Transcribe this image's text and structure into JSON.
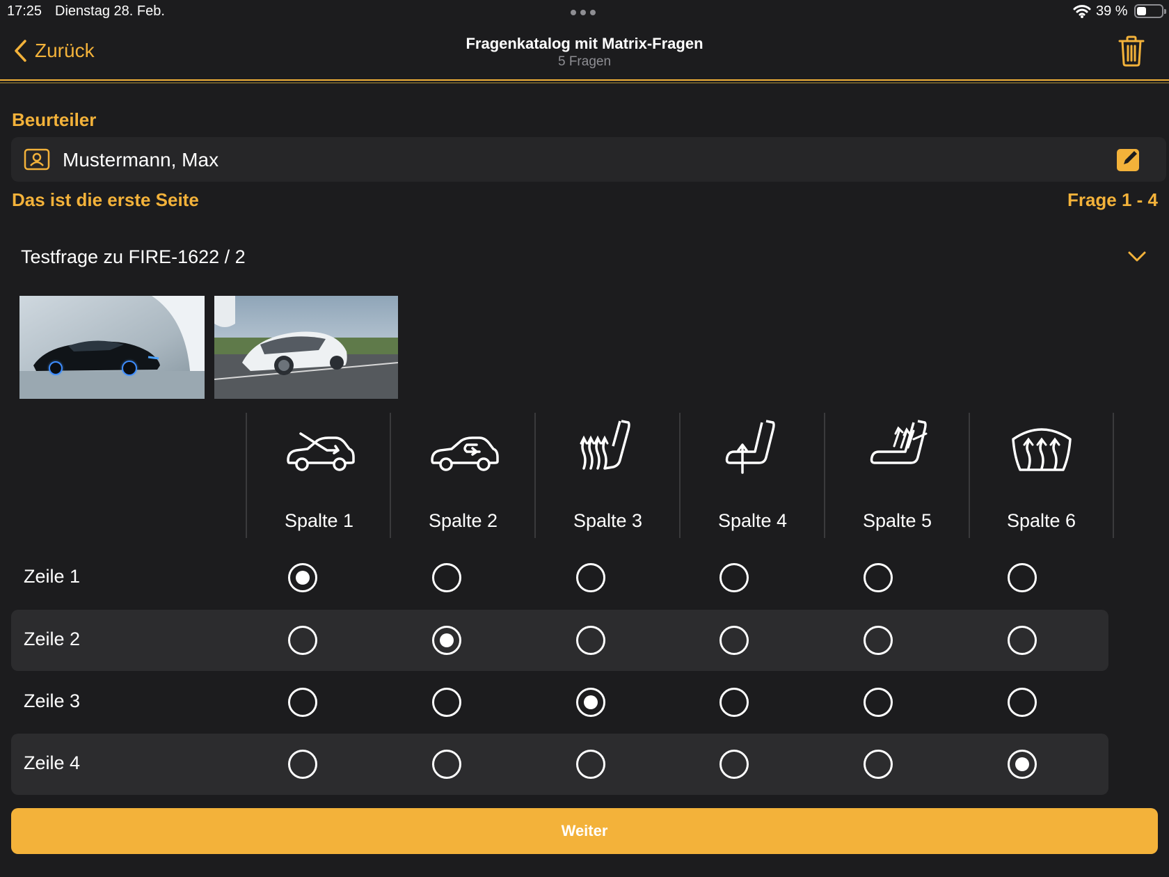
{
  "status_bar": {
    "time": "17:25",
    "date": "Dienstag 28. Feb.",
    "battery": "39 %",
    "battery_level": 0.39
  },
  "nav": {
    "back_label": "Zurück",
    "title": "Fragenkatalog mit Matrix-Fragen",
    "subtitle": "5 Fragen"
  },
  "assessor": {
    "section_label": "Beurteiler",
    "name": "Mustermann, Max"
  },
  "page": {
    "title": "Das ist die erste Seite",
    "range": "Frage 1 - 4"
  },
  "question": {
    "title": "Testfrage zu FIRE-1622 / 2"
  },
  "matrix": {
    "columns": [
      {
        "label": "Spalte 1",
        "icon": "car-recirculation-off-icon"
      },
      {
        "label": "Spalte 2",
        "icon": "car-recirculation-icon"
      },
      {
        "label": "Spalte 3",
        "icon": "seat-heating-icon"
      },
      {
        "label": "Spalte 4",
        "icon": "seat-ventilation-icon"
      },
      {
        "label": "Spalte 5",
        "icon": "seat-climate-icon"
      },
      {
        "label": "Spalte 6",
        "icon": "windshield-defrost-icon"
      }
    ],
    "rows": [
      {
        "label": "Zeile 1",
        "selected": 0
      },
      {
        "label": "Zeile 2",
        "selected": 1
      },
      {
        "label": "Zeile 3",
        "selected": 2
      },
      {
        "label": "Zeile 4",
        "selected": 5
      }
    ]
  },
  "actions": {
    "next_label": "Weiter"
  },
  "colors": {
    "accent": "#f3b23a",
    "background": "#1c1c1e",
    "card": "#262628",
    "row_alt": "#2c2c2e"
  }
}
